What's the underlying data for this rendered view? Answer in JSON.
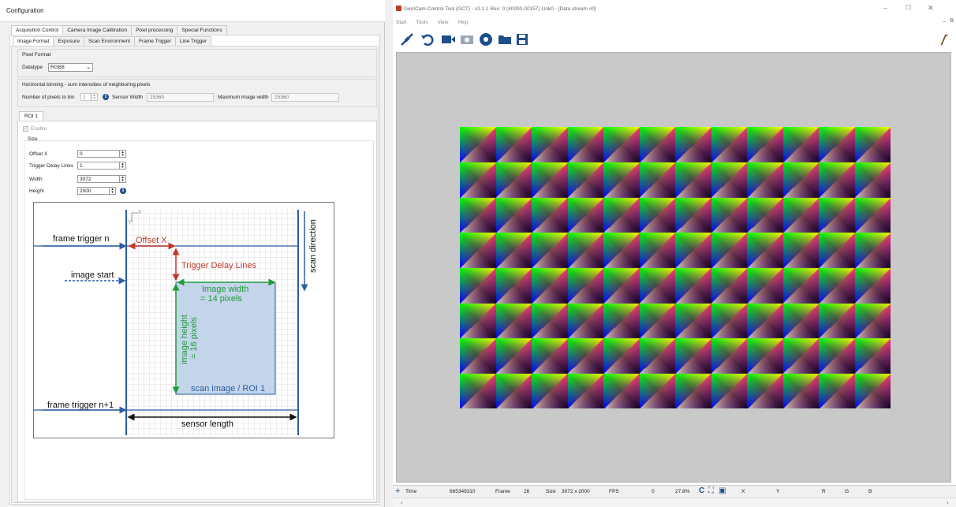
{
  "left_window": {
    "title": "Configuration",
    "tabs_top": [
      "Acquisition Control",
      "Camera Image Calibration",
      "Pixel processing",
      "Special Functions"
    ],
    "tabs_sub": [
      "Image Format",
      "Exposure",
      "Scan Environment",
      "Frame Trigger",
      "Line Trigger"
    ],
    "pixel_format": {
      "group_label": "Pixel Format",
      "datatype_label": "Datatype",
      "datatype_value": "RGB8"
    },
    "binning": {
      "group_label": "Horizontal binning - sum intensities of neighboring pixels",
      "num_label": "Number of pixels to bin",
      "num_value": "1",
      "sensor_width_label": "Sensor Width",
      "sensor_width_value": "15360",
      "max_width_label": "Maximum image width",
      "max_width_value": "15360"
    },
    "roi": {
      "tab": "ROI 1",
      "enable_label": "Enable",
      "size_label": "Size",
      "fields": [
        {
          "label": "Offset X",
          "value": "0"
        },
        {
          "label": "Trigger Delay Lines",
          "value": "1"
        },
        {
          "label": "Width",
          "value": "3072"
        },
        {
          "label": "Height",
          "value": "2000"
        }
      ]
    },
    "diagram": {
      "frame_trigger_n": "frame trigger n",
      "offset_x": "Offset X",
      "trigger_delay_lines": "Trigger Delay Lines",
      "image_start": "image start",
      "image_width_1": "Image width",
      "image_width_2": "= 14 pixels",
      "image_height_1": "image height",
      "image_height_2": "= 16 pixels",
      "scan_image": "scan image / ROI 1",
      "frame_trigger_n1": "frame trigger n+1",
      "sensor_length": "sensor length",
      "scan_direction": "scan direction",
      "axis_x": "X",
      "axis_y": "Y"
    }
  },
  "right_window": {
    "title": "GenICam Control Tool (GCT) - v2.1.1 Rev: 0  (40000-00157) Link0  - [Data stream #0]",
    "menu": [
      "Start",
      "Tools",
      "View",
      "Help"
    ],
    "status": {
      "time_label": "Time",
      "time_value": "665349310",
      "frame_label": "Frame",
      "frame_value": "26",
      "size_label": "Size",
      "size_value": "3072 x 2000",
      "fps_label": "FPS",
      "fps_value": "0",
      "zoom_value": "27.8%",
      "x_label": "X",
      "y_label": "Y",
      "r_label": "R",
      "g_label": "G",
      "b_label": "B"
    }
  }
}
